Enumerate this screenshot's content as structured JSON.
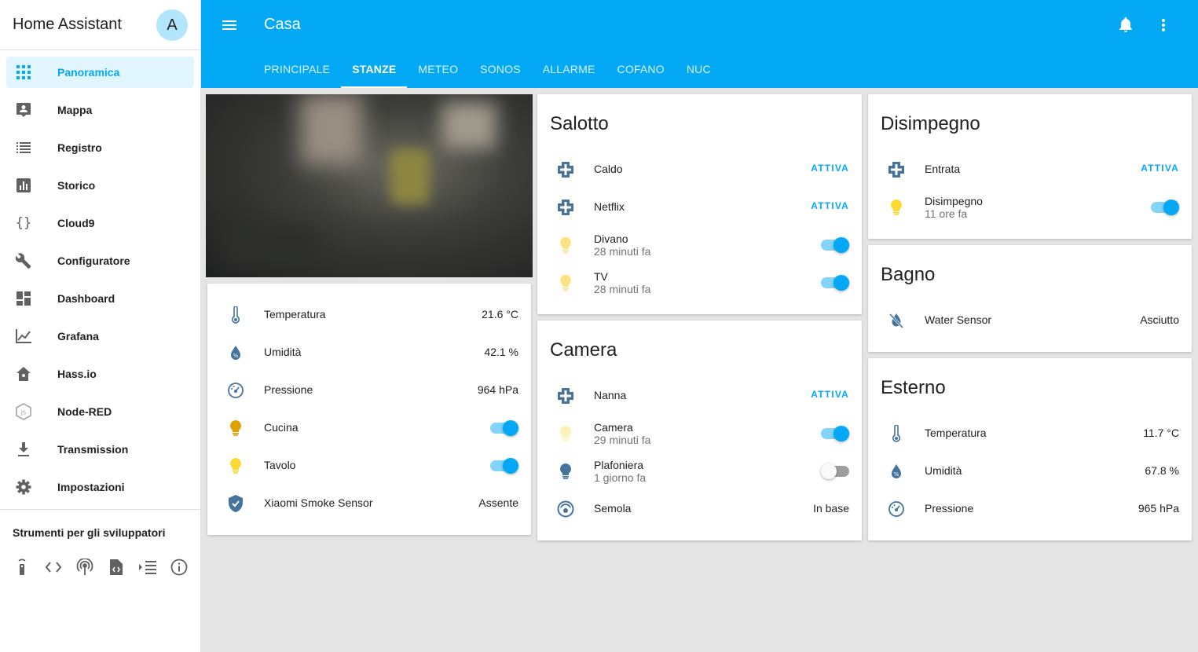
{
  "sidebar": {
    "title": "Home Assistant",
    "avatar_letter": "A",
    "items": [
      {
        "label": "Panoramica",
        "icon": "grid-icon"
      },
      {
        "label": "Mappa",
        "icon": "map-account-icon"
      },
      {
        "label": "Registro",
        "icon": "list-icon"
      },
      {
        "label": "Storico",
        "icon": "chart-box-icon"
      },
      {
        "label": "Cloud9",
        "icon": "code-braces-icon"
      },
      {
        "label": "Configuratore",
        "icon": "wrench-icon"
      },
      {
        "label": "Dashboard",
        "icon": "dashboard-icon"
      },
      {
        "label": "Grafana",
        "icon": "line-chart-icon"
      },
      {
        "label": "Hass.io",
        "icon": "hassio-icon"
      },
      {
        "label": "Node-RED",
        "icon": "nodejs-icon"
      },
      {
        "label": "Transmission",
        "icon": "download-icon"
      },
      {
        "label": "Impostazioni",
        "icon": "gear-icon"
      }
    ],
    "dev_tools_title": "Strumenti per gli sviluppatori",
    "dev_tools": [
      "remote-icon",
      "code-tags-icon",
      "radio-tower-icon",
      "file-xml-icon",
      "format-list-icon",
      "info-icon"
    ]
  },
  "header": {
    "title": "Casa",
    "tabs": [
      "PRINCIPALE",
      "STANZE",
      "METEO",
      "SONOS",
      "ALLARME",
      "COFANO",
      "NUC"
    ],
    "active_tab": "STANZE"
  },
  "colors": {
    "accent": "#03a9f4",
    "state_blue": "#44739e",
    "light_on": "#fdd835",
    "light_dim": "#ffe082"
  },
  "col1": {
    "rows": [
      {
        "name": "Temperatura",
        "value": "21.6 °C",
        "icon": "thermometer-icon"
      },
      {
        "name": "Umidità",
        "value": "42.1 %",
        "icon": "water-percent-icon"
      },
      {
        "name": "Pressione",
        "value": "964 hPa",
        "icon": "gauge-icon"
      },
      {
        "name": "Cucina",
        "toggle": "on",
        "icon": "lightbulb-icon"
      },
      {
        "name": "Tavolo",
        "toggle": "on",
        "icon": "lightbulb-icon"
      },
      {
        "name": "Xiaomi Smoke Sensor",
        "value": "Assente",
        "icon": "shield-check-icon"
      }
    ]
  },
  "salotto": {
    "title": "Salotto",
    "rows": [
      {
        "name": "Caldo",
        "action": "ATTIVA",
        "icon": "scene-icon"
      },
      {
        "name": "Netflix",
        "action": "ATTIVA",
        "icon": "scene-icon"
      },
      {
        "name": "Divano",
        "sub": "28 minuti fa",
        "toggle": "on",
        "icon": "lightbulb-icon"
      },
      {
        "name": "TV",
        "sub": "28 minuti fa",
        "toggle": "on",
        "icon": "lightbulb-icon"
      }
    ]
  },
  "camera_room": {
    "title": "Camera",
    "rows": [
      {
        "name": "Nanna",
        "action": "ATTIVA",
        "icon": "scene-icon"
      },
      {
        "name": "Camera",
        "sub": "29 minuti fa",
        "toggle": "on",
        "icon": "lightbulb-icon"
      },
      {
        "name": "Plafoniera",
        "sub": "1 giorno fa",
        "toggle": "off",
        "icon": "lightbulb-icon"
      },
      {
        "name": "Semola",
        "value": "In base",
        "icon": "robot-vacuum-icon"
      }
    ]
  },
  "disimpegno": {
    "title": "Disimpegno",
    "rows": [
      {
        "name": "Entrata",
        "action": "ATTIVA",
        "icon": "scene-icon"
      },
      {
        "name": "Disimpegno",
        "sub": "11 ore fa",
        "toggle": "on",
        "icon": "lightbulb-icon"
      }
    ]
  },
  "bagno": {
    "title": "Bagno",
    "rows": [
      {
        "name": "Water Sensor",
        "value": "Asciutto",
        "icon": "water-off-icon"
      }
    ]
  },
  "esterno": {
    "title": "Esterno",
    "rows": [
      {
        "name": "Temperatura",
        "value": "11.7 °C",
        "icon": "thermometer-icon"
      },
      {
        "name": "Umidità",
        "value": "67.8 %",
        "icon": "water-percent-icon"
      },
      {
        "name": "Pressione",
        "value": "965 hPa",
        "icon": "gauge-icon"
      }
    ]
  }
}
